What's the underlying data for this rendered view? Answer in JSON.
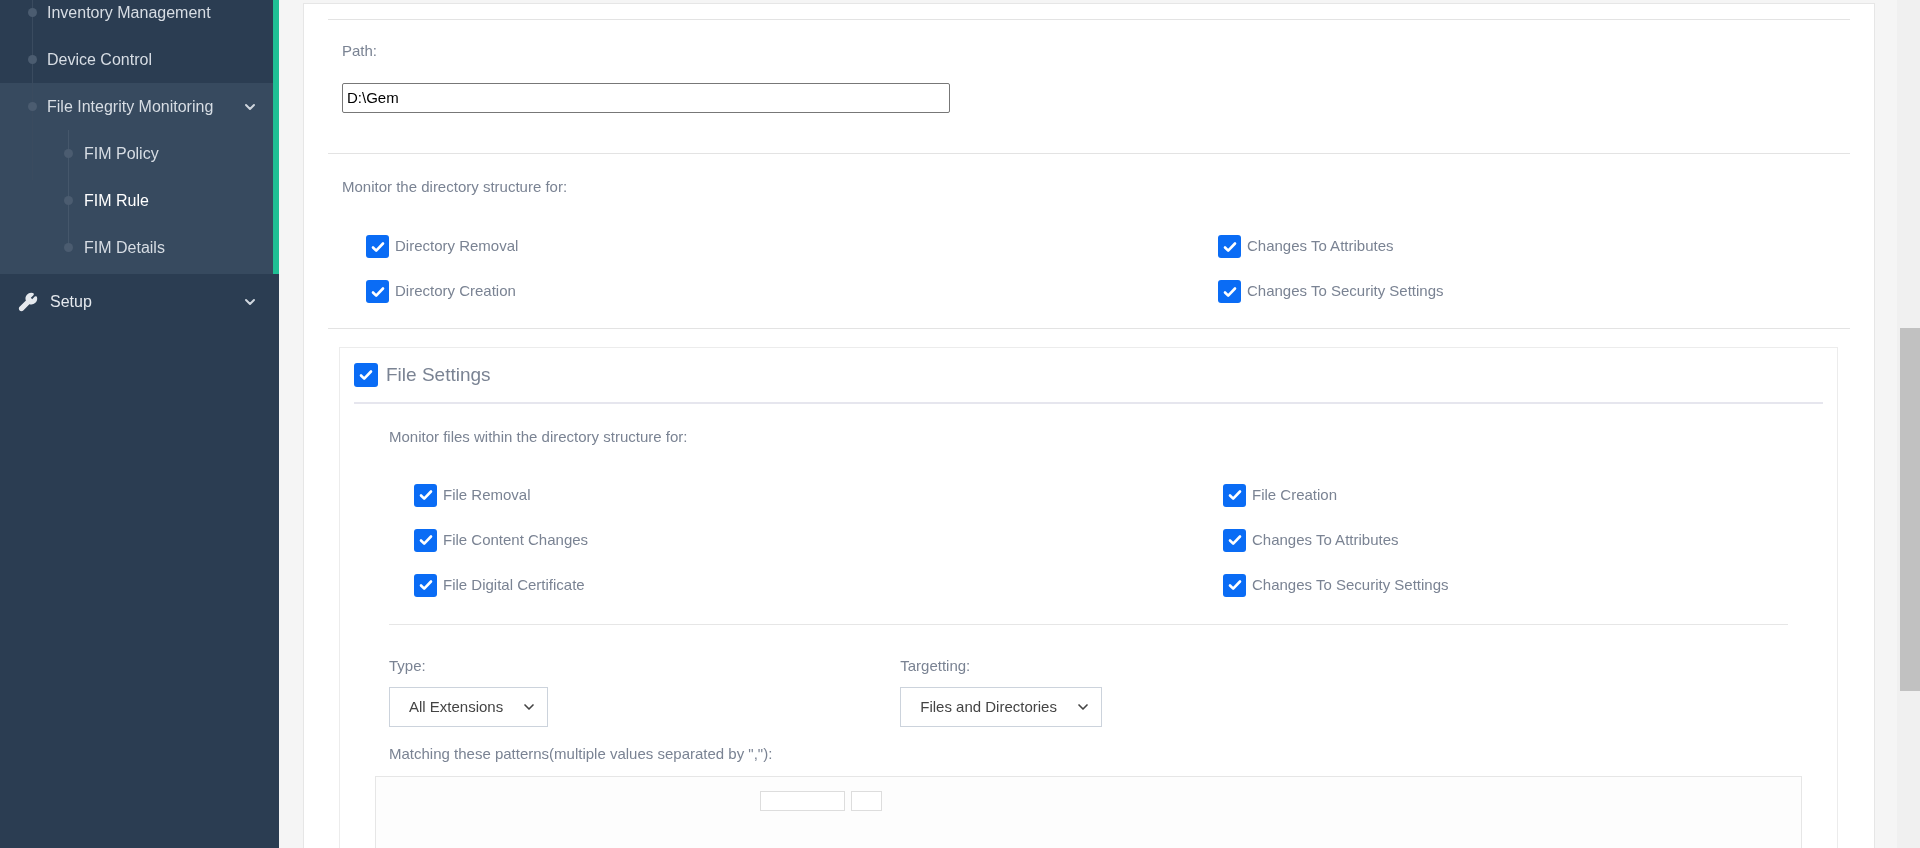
{
  "sidebar": {
    "items": [
      {
        "label": "Inventory Management",
        "selected": false
      },
      {
        "label": "Device Control",
        "selected": false
      },
      {
        "label": "File Integrity Monitoring",
        "selected": false,
        "children": [
          {
            "label": "FIM Policy",
            "selected": false
          },
          {
            "label": "FIM Rule",
            "selected": true
          },
          {
            "label": "FIM Details",
            "selected": false
          }
        ]
      }
    ],
    "setup": {
      "label": "Setup"
    }
  },
  "path": {
    "label": "Path:",
    "value": "D:\\Gem"
  },
  "directory": {
    "label": "Monitor the directory structure for:",
    "options": [
      {
        "label": "Directory Removal",
        "checked": true
      },
      {
        "label": "Changes To Attributes",
        "checked": true
      },
      {
        "label": "Directory Creation",
        "checked": true
      },
      {
        "label": "Changes To Security Settings",
        "checked": true
      }
    ]
  },
  "file_settings": {
    "title": "File Settings",
    "checked": true,
    "label": "Monitor files within the directory structure for:",
    "options": [
      {
        "label": "File Removal",
        "checked": true
      },
      {
        "label": "File Creation",
        "checked": true
      },
      {
        "label": "File Content Changes",
        "checked": true
      },
      {
        "label": "Changes To Attributes",
        "checked": true
      },
      {
        "label": "File Digital Certificate",
        "checked": true
      },
      {
        "label": "Changes To Security Settings",
        "checked": true
      }
    ],
    "type": {
      "label": "Type:",
      "value": "All Extensions"
    },
    "targetting": {
      "label": "Targetting:",
      "value": "Files and Directories"
    },
    "patterns": {
      "label": "Matching these patterns(multiple values separated by \",\"):"
    }
  }
}
